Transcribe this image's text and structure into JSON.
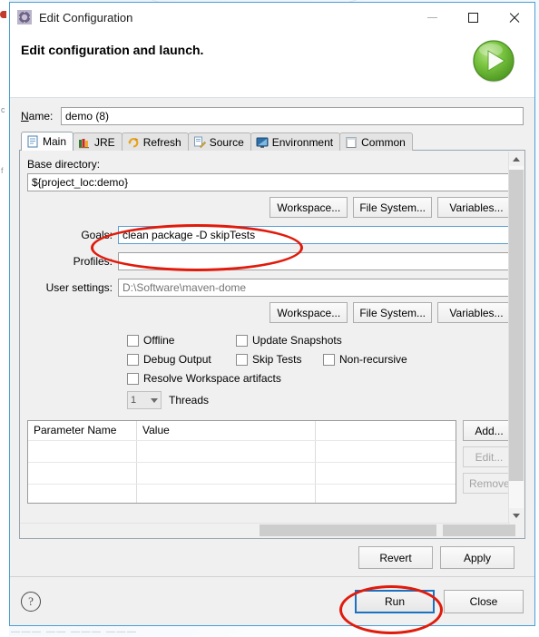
{
  "window": {
    "title": "Edit Configuration",
    "app_icon": "gear-icon",
    "controls": {
      "minimize": "–",
      "maximize": "□",
      "close": "✕"
    }
  },
  "header": {
    "title": "Edit configuration and launch.",
    "run_icon": "green-run-play-icon"
  },
  "name_field": {
    "label": "Name:",
    "value": "demo (8)",
    "placeholder": ""
  },
  "tabs": [
    {
      "label": "Main",
      "icon": "document-icon",
      "active": true
    },
    {
      "label": "JRE",
      "icon": "books-icon",
      "active": false
    },
    {
      "label": "Refresh",
      "icon": "refresh-icon",
      "active": false
    },
    {
      "label": "Source",
      "icon": "source-edit-icon",
      "active": false
    },
    {
      "label": "Environment",
      "icon": "monitor-icon",
      "active": false
    },
    {
      "label": "Common",
      "icon": "page-icon",
      "active": false
    }
  ],
  "main_tab": {
    "base_directory": {
      "label": "Base directory:",
      "value": "${project_loc:demo}"
    },
    "base_dir_buttons": [
      {
        "label": "Workspace...",
        "accel": "W"
      },
      {
        "label": "File System...",
        "accel": "m"
      },
      {
        "label": "Variables...",
        "accel": "V"
      }
    ],
    "goals": {
      "label": "Goals:",
      "value": "clean package -D skipTests",
      "focused": true
    },
    "profiles": {
      "label": "Profiles:",
      "value": ""
    },
    "user_settings": {
      "label": "User settings:",
      "value": "",
      "placeholder": "D:\\Software\\maven-dome"
    },
    "user_settings_buttons": [
      {
        "label": "Workspace...",
        "accel": "W"
      },
      {
        "label": "File System...",
        "accel": "m"
      },
      {
        "label": "Variables...",
        "accel": "V"
      }
    ],
    "checkboxes": [
      {
        "label": "Offline",
        "checked": false
      },
      {
        "label": "Update Snapshots",
        "checked": false
      },
      {
        "label": "Debug Output",
        "checked": false
      },
      {
        "label": "Skip Tests",
        "checked": false
      },
      {
        "label": "Non-recursive",
        "checked": false
      },
      {
        "label": "Resolve Workspace artifacts",
        "checked": false
      }
    ],
    "threads": {
      "value": "1",
      "label": "Threads"
    },
    "parameter_table": {
      "columns": [
        "Parameter Name",
        "Value",
        ""
      ],
      "rows": [],
      "empty_row_count": 3
    },
    "table_buttons": [
      {
        "label": "Add...",
        "enabled": true
      },
      {
        "label": "Edit...",
        "enabled": false
      },
      {
        "label": "Remove",
        "enabled": false
      }
    ]
  },
  "apply_bar": {
    "revert": "Revert",
    "apply": "Apply"
  },
  "footer": {
    "help": "?",
    "run": "Run",
    "close": "Close"
  },
  "annotations": [
    {
      "name": "goals-highlight",
      "shape": "ellipse",
      "color": "#e01b0c",
      "target": "goals-input"
    },
    {
      "name": "run-highlight",
      "shape": "ellipse",
      "color": "#e01b0c",
      "target": "run-button"
    }
  ],
  "background": {
    "left_text_1": "c",
    "left_text_2": "f",
    "bottom_text": "——— —— ———  ———"
  }
}
